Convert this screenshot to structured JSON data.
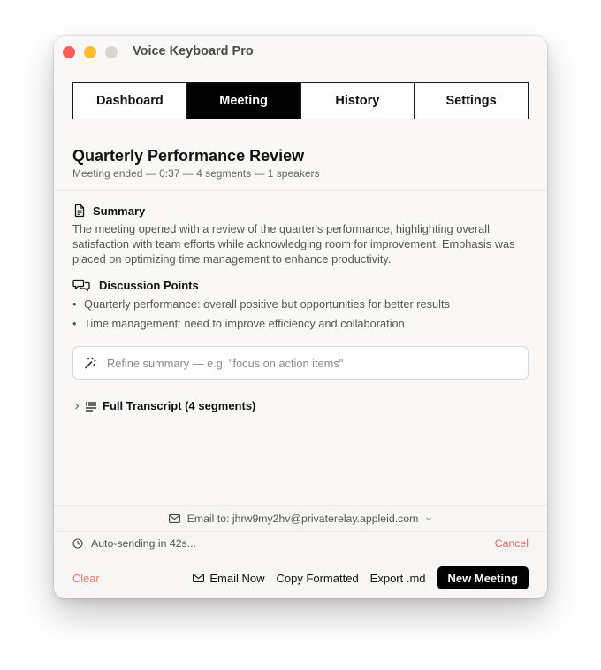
{
  "window": {
    "title": "Voice Keyboard Pro"
  },
  "tabs": [
    {
      "label": "Dashboard",
      "active": false
    },
    {
      "label": "Meeting",
      "active": true
    },
    {
      "label": "History",
      "active": false
    },
    {
      "label": "Settings",
      "active": false
    }
  ],
  "meeting": {
    "title": "Quarterly Performance Review",
    "meta": "Meeting ended — 0:37 — 4 segments — 1 speakers"
  },
  "summary": {
    "heading": "Summary",
    "icon": "document-icon",
    "text": "The meeting opened with a review of the quarter's performance, highlighting overall satisfaction with team efforts while acknowledging room for improvement. Emphasis was placed on optimizing time management to enhance productivity."
  },
  "discussion": {
    "heading": "Discussion Points",
    "icon": "chat-bubbles-icon",
    "items": [
      "Quarterly performance: overall positive but opportunities for better results",
      "Time management: need to improve efficiency and collaboration"
    ]
  },
  "refine": {
    "placeholder": "Refine summary — e.g. \"focus on action items\"",
    "value": ""
  },
  "transcript": {
    "label": "Full Transcript (4 segments)"
  },
  "footer": {
    "email_to": "Email to: jhrw9my2hv@privaterelay.appleid.com",
    "autosend": "Auto-sending in 42s...",
    "cancel": "Cancel",
    "clear": "Clear",
    "email_now": "Email Now",
    "copy_formatted": "Copy Formatted",
    "export_md": "Export .md",
    "new_meeting": "New Meeting"
  },
  "colors": {
    "accent_red": "#e06666",
    "primary_button": "#000000",
    "active_tab": "#000000"
  }
}
